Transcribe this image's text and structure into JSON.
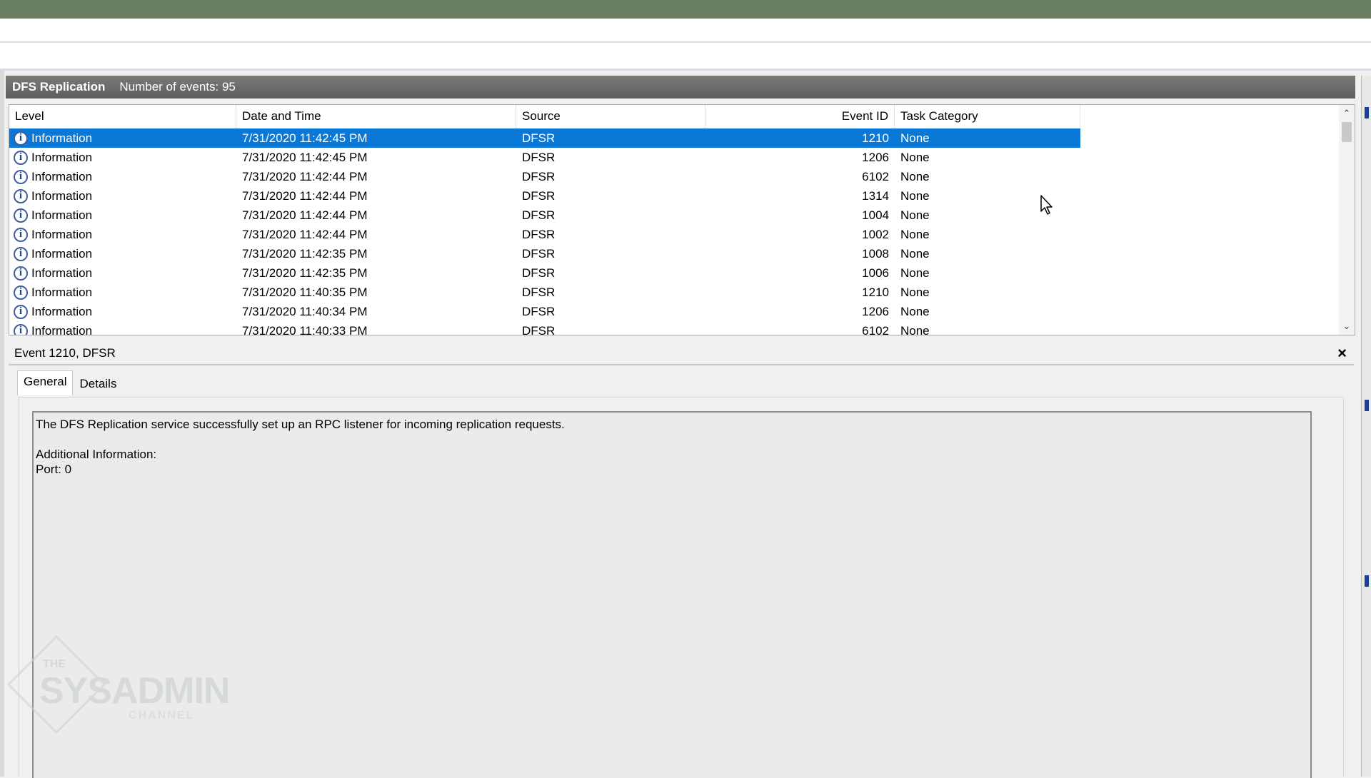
{
  "log": {
    "name": "DFS Replication",
    "count_label": "Number of events: 95"
  },
  "columns": {
    "level": "Level",
    "date": "Date and Time",
    "source": "Source",
    "event_id": "Event ID",
    "task": "Task Category"
  },
  "rows": [
    {
      "level": "Information",
      "date": "7/31/2020 11:42:45 PM",
      "source": "DFSR",
      "event_id": "1210",
      "task": "None",
      "selected": true
    },
    {
      "level": "Information",
      "date": "7/31/2020 11:42:45 PM",
      "source": "DFSR",
      "event_id": "1206",
      "task": "None"
    },
    {
      "level": "Information",
      "date": "7/31/2020 11:42:44 PM",
      "source": "DFSR",
      "event_id": "6102",
      "task": "None"
    },
    {
      "level": "Information",
      "date": "7/31/2020 11:42:44 PM",
      "source": "DFSR",
      "event_id": "1314",
      "task": "None"
    },
    {
      "level": "Information",
      "date": "7/31/2020 11:42:44 PM",
      "source": "DFSR",
      "event_id": "1004",
      "task": "None"
    },
    {
      "level": "Information",
      "date": "7/31/2020 11:42:44 PM",
      "source": "DFSR",
      "event_id": "1002",
      "task": "None"
    },
    {
      "level": "Information",
      "date": "7/31/2020 11:42:35 PM",
      "source": "DFSR",
      "event_id": "1008",
      "task": "None"
    },
    {
      "level": "Information",
      "date": "7/31/2020 11:42:35 PM",
      "source": "DFSR",
      "event_id": "1006",
      "task": "None"
    },
    {
      "level": "Information",
      "date": "7/31/2020 11:40:35 PM",
      "source": "DFSR",
      "event_id": "1210",
      "task": "None"
    },
    {
      "level": "Information",
      "date": "7/31/2020 11:40:34 PM",
      "source": "DFSR",
      "event_id": "1206",
      "task": "None"
    },
    {
      "level": "Information",
      "date": "7/31/2020 11:40:33 PM",
      "source": "DFSR",
      "event_id": "6102",
      "task": "None"
    }
  ],
  "detail": {
    "title": "Event 1210, DFSR",
    "close_glyph": "×",
    "tabs": [
      "General",
      "Details"
    ],
    "message": "The DFS Replication service successfully set up an RPC listener for incoming replication requests.",
    "additional_label": "Additional Information:",
    "port_line": "Port: 0"
  },
  "scrollbar": {
    "up_glyph": "⌃",
    "down_glyph": "⌄"
  },
  "watermark": {
    "line1": "THE",
    "line2": "SYSADMIN",
    "line3": "CHANNEL"
  },
  "icons": {
    "level_icon": "info-icon",
    "info_glyph": "i"
  },
  "colors": {
    "selection": "#0a78d7",
    "title_bar": "#6a7f62"
  }
}
